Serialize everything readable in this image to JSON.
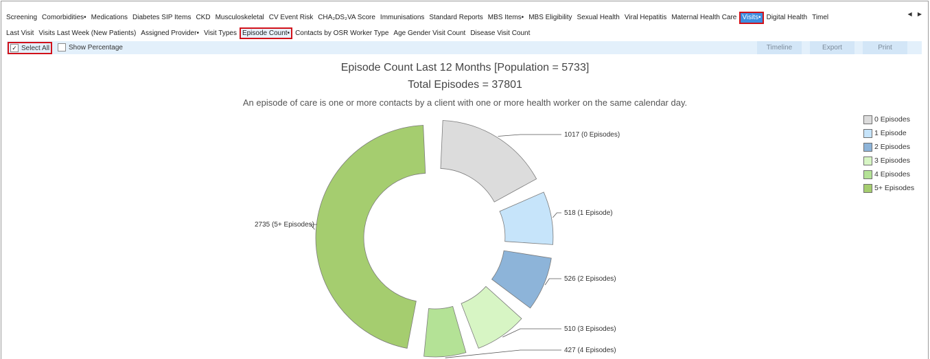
{
  "main_tabs": [
    {
      "label": "Screening"
    },
    {
      "label": "Comorbidities•"
    },
    {
      "label": "Medications"
    },
    {
      "label": "Diabetes SIP Items"
    },
    {
      "label": "CKD"
    },
    {
      "label": "Musculoskeletal"
    },
    {
      "label": "CV Event Risk"
    },
    {
      "label": "CHA₂DS₂VA Score"
    },
    {
      "label": "Immunisations"
    },
    {
      "label": "Standard Reports"
    },
    {
      "label": "MBS Items•"
    },
    {
      "label": "MBS Eligibility"
    },
    {
      "label": "Sexual Health"
    },
    {
      "label": "Viral Hepatitis"
    },
    {
      "label": "Maternal Health Care"
    },
    {
      "label": "Visits•"
    },
    {
      "label": "Digital Health"
    },
    {
      "label": "Timel"
    }
  ],
  "tab_scroll": {
    "left": "◀",
    "right": "▶"
  },
  "sub_tabs": [
    {
      "label": "Last Visit"
    },
    {
      "label": "Visits Last Week (New Patients)"
    },
    {
      "label": "Assigned Provider•"
    },
    {
      "label": "Visit Types"
    },
    {
      "label": "Episode Count•"
    },
    {
      "label": "Contacts by OSR Worker Type"
    },
    {
      "label": "Age Gender Visit Count"
    },
    {
      "label": "Disease Visit Count"
    }
  ],
  "toolbar": {
    "select_all": "Select All",
    "select_all_check": "✓",
    "show_percentage": "Show Percentage",
    "timeline": "Timeline",
    "export": "Export",
    "print": "Print"
  },
  "chart_data": {
    "type": "pie",
    "title": "Episode Count Last 12 Months [Population = 5733]",
    "subtitle": "Total Episodes = 37801",
    "annotation": "An episode of care is one or more contacts by a client with one or more health worker on the same calendar day.",
    "legend_position": "right",
    "categories": [
      "0 Episodes",
      "1 Episode",
      "2 Episodes",
      "3 Episodes",
      "4 Episodes",
      "5+ Episodes"
    ],
    "values": [
      1017,
      518,
      526,
      510,
      427,
      2735
    ],
    "data_labels": [
      "1017 (0 Episodes)",
      "518 (1 Episode)",
      "526 (2 Episodes)",
      "510 (3 Episodes)",
      "427 (4 Episodes)",
      "2735 (5+ Episodes)"
    ],
    "colors": [
      "#dcdcdc",
      "#c6e4fa",
      "#8db4d9",
      "#d7f5c4",
      "#b4e296",
      "#a5cd6f"
    ]
  }
}
